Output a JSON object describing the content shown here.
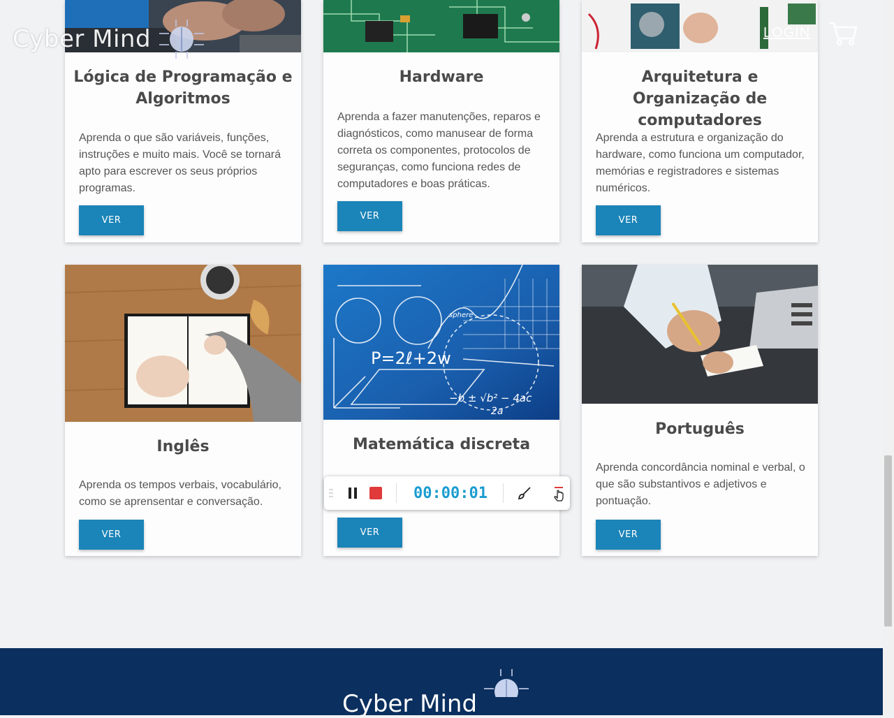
{
  "header": {
    "logo_text": "Cyber Mind",
    "login_label": "LOGIN"
  },
  "cards": [
    {
      "title": "Lógica de Programação e Algoritmos",
      "text": "Aprenda o que são variáveis, funções, instruções e muito mais. Você se tornará apto para escrever os seus próprios programas.",
      "button": "VER",
      "image": "laptop-typing"
    },
    {
      "title": "Hardware",
      "text": "Aprenda a fazer manutenções, reparos e diagnósticos, como manusear de forma correta os componentes, protocolos de seguranças, como funciona redes de computadores e boas práticas.",
      "button": "VER",
      "image": "circuit-board"
    },
    {
      "title": "Arquitetura e Organização de computadores",
      "text": "Aprenda a estrutura e organização do hardware, como funciona um computador, memórias e registradores e sistemas numéricos.",
      "button": "VER",
      "image": "hard-drive-repair"
    },
    {
      "title": "Inglês",
      "text": "Aprenda os tempos verbais, vocabulário, como se aprensentar e conversação.",
      "button": "VER",
      "image": "notebook-writing"
    },
    {
      "title": "Matemática discreta",
      "text": "",
      "button": "VER",
      "image": "math-formulas"
    },
    {
      "title": "Português",
      "text": "Aprenda concordância nominal e verbal, o que são substantivos e adjetivos e pontuação.",
      "button": "VER",
      "image": "writing-desk"
    }
  ],
  "math_image": {
    "formula_main": "P=2ℓ+2w",
    "formula_quad": "−b ± √b² − 4ac",
    "formula_den": "2a",
    "label_sphere": "sphere"
  },
  "recorder": {
    "timer": "00:00:01",
    "accent": "#1b9ccf",
    "stop_color": "#e03a3a"
  },
  "footer": {
    "logo_text": "Cyber Mind",
    "background": "#0b2f5e"
  },
  "colors": {
    "button": "#1b84b8"
  }
}
